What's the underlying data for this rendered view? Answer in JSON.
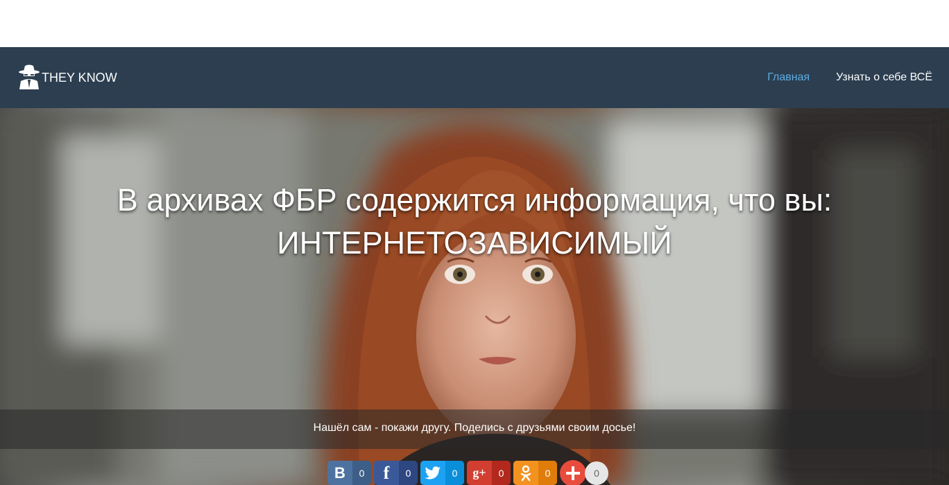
{
  "nav": {
    "brand": "THEY KNOW",
    "links": [
      {
        "label": "Главная",
        "active": true
      },
      {
        "label": "Узнать о себе ВСЁ",
        "active": false
      }
    ]
  },
  "hero": {
    "title_line1": "В архивах ФБР содержится информация, что вы:",
    "title_line2": "ИНТЕРНЕТОЗАВИСИМЫЙ",
    "caption": "Нашёл сам - покажи другу. Поделись с друзьями своим досье!"
  },
  "share": {
    "buttons": [
      {
        "network": "vkontakte",
        "icon": "vk-icon",
        "glyph": "В",
        "count": "0",
        "color": "#4e72a0",
        "count_color": "#3d5e87"
      },
      {
        "network": "facebook",
        "icon": "facebook-icon",
        "glyph": "f",
        "count": "0",
        "color": "#3b5998",
        "count_color": "#2e4781"
      },
      {
        "network": "twitter",
        "icon": "twitter-icon",
        "glyph": "t",
        "count": "0",
        "color": "#1da1f2",
        "count_color": "#0b8ed9"
      },
      {
        "network": "google-plus",
        "icon": "google-plus-icon",
        "glyph": "g+",
        "count": "0",
        "color": "#d23f31",
        "count_color": "#b3281c"
      },
      {
        "network": "odnoklassniki",
        "icon": "odnoklassniki-icon",
        "glyph": "ok",
        "count": "0",
        "color": "#f4921f",
        "count_color": "#e07d0a"
      }
    ],
    "more_count": "0",
    "more_color": "#e74c3c"
  }
}
